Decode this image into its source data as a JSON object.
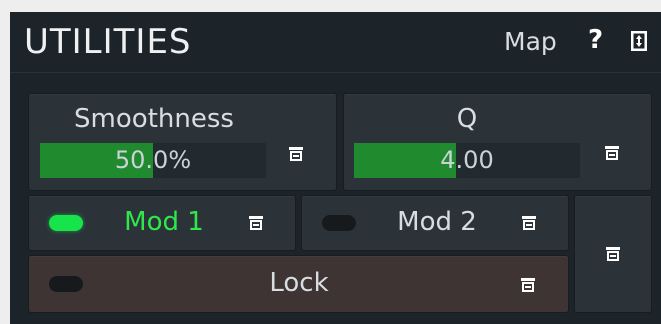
{
  "header": {
    "title": "UTILITIES",
    "map_label": "Map",
    "help_label": "?"
  },
  "smoothness": {
    "label": "Smoothness",
    "value_text": "50.0%",
    "fraction": 0.5
  },
  "q": {
    "label": "Q",
    "value_text": "4.00",
    "fraction": 0.45
  },
  "mod1": {
    "label": "Mod 1",
    "active": true
  },
  "mod2": {
    "label": "Mod 2",
    "active": false
  },
  "lock": {
    "label": "Lock",
    "active": false
  },
  "colors": {
    "accent_green": "#1f8b2e",
    "led_on": "#17e34a",
    "active_text": "#2ee84b",
    "panel_bg": "#1d2429"
  },
  "icons": [
    "help-icon",
    "arrange-icon",
    "menu-icon"
  ]
}
